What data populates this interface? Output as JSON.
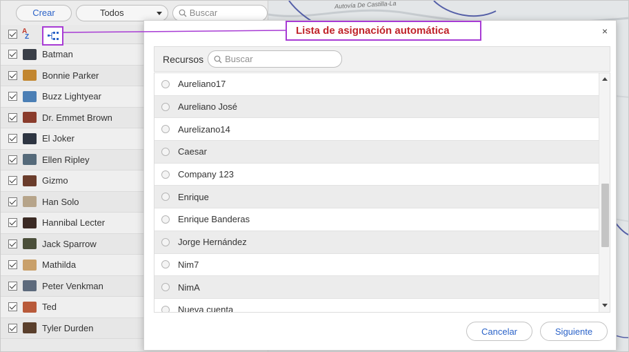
{
  "toolbar": {
    "create_label": "Crear",
    "filter_value": "Todos",
    "search_placeholder": "Buscar"
  },
  "map": {
    "road_label": "Autovía De Castilla-La"
  },
  "callout": {
    "text": "Lista de asignación automática"
  },
  "resources": [
    {
      "name": "Batman",
      "color": "#3a3f48"
    },
    {
      "name": "Bonnie Parker",
      "color": "#c2862f"
    },
    {
      "name": "Buzz Lightyear",
      "color": "#4b7fb5"
    },
    {
      "name": "Dr. Emmet Brown",
      "color": "#8a3c2c"
    },
    {
      "name": "El Joker",
      "color": "#2e3542"
    },
    {
      "name": "Ellen Ripley",
      "color": "#556a7a"
    },
    {
      "name": "Gizmo",
      "color": "#6b3d2c"
    },
    {
      "name": "Han Solo",
      "color": "#b6a48a"
    },
    {
      "name": "Hannibal Lecter",
      "color": "#3b2a24"
    },
    {
      "name": "Jack Sparrow",
      "color": "#4b4f3a"
    },
    {
      "name": "Mathilda",
      "color": "#c9a06a"
    },
    {
      "name": "Peter Venkman",
      "color": "#5d6a7c"
    },
    {
      "name": "Ted",
      "color": "#b85a3a"
    },
    {
      "name": "Tyler Durden",
      "color": "#5a3f2c"
    }
  ],
  "modal": {
    "close_label": "×",
    "header_title": "Recursos",
    "search_placeholder": "Buscar",
    "items": [
      "Aureliano17",
      "Aureliano José",
      "Aurelizano14",
      "Caesar",
      "Company 123",
      "Enrique",
      "Enrique Banderas",
      "Jorge Hernández",
      "Nim7",
      "NimA",
      "Nueva cuenta"
    ],
    "cancel_label": "Cancelar",
    "next_label": "Siguiente"
  },
  "colors": {
    "accent_link": "#2a62c8",
    "callout_border": "#a73ad4",
    "callout_text": "#c0232a"
  }
}
